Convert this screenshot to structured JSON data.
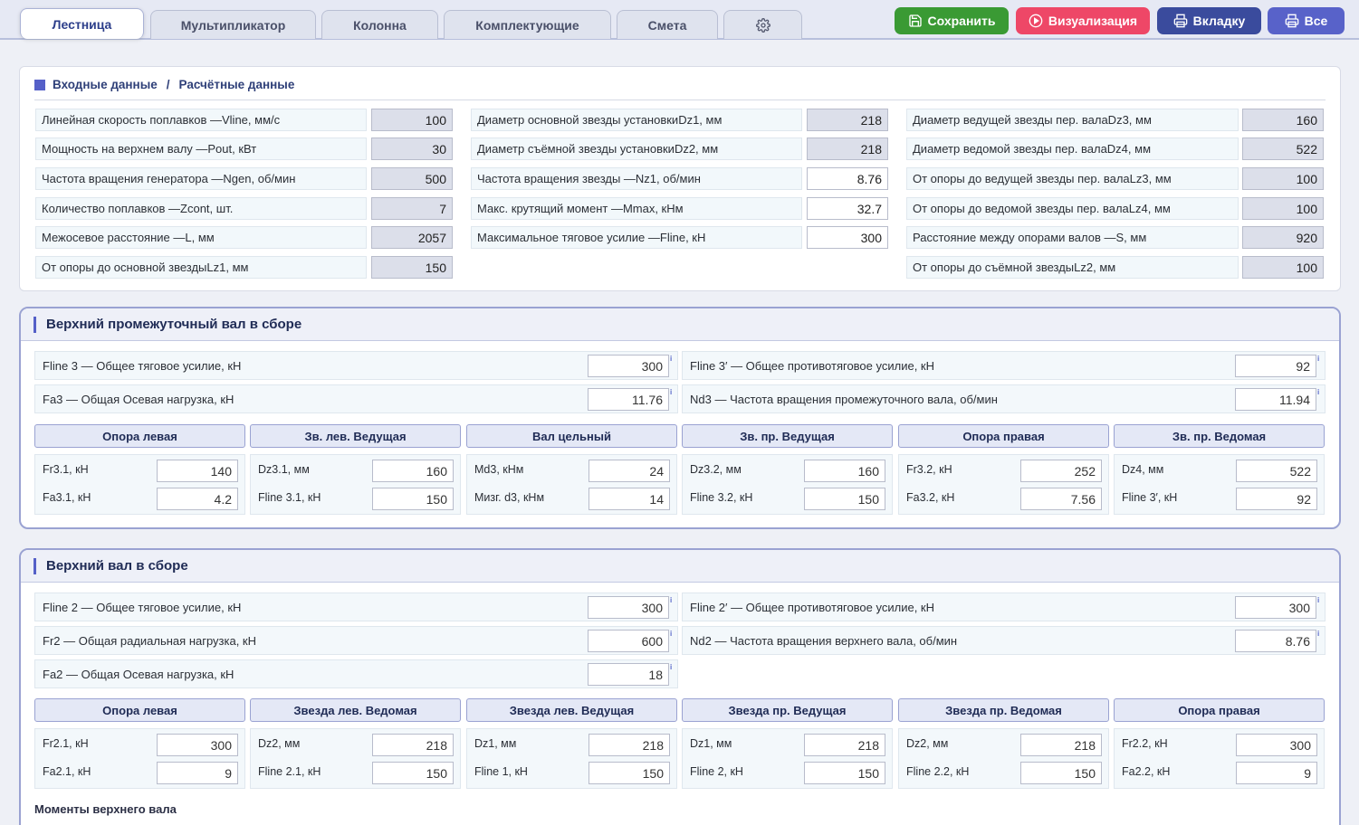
{
  "tabs": [
    "Лестница",
    "Мультипликатор",
    "Колонна",
    "Комплектующие",
    "Смета"
  ],
  "toolbar": {
    "save": "Сохранить",
    "visual": "Визуализация",
    "tab_print": "Вкладку",
    "all_print": "Все",
    "colors": {
      "save": "#3a9a34",
      "visual": "#ee4767",
      "tab_print": "#3a4b9d",
      "all_print": "#5862c9"
    }
  },
  "input_card": {
    "title_in": "Входные данные",
    "sep": "/",
    "title_out": "Расчётные данные",
    "col1": [
      {
        "label": "Линейная скорость поплавков —Vline, мм/с",
        "value": "100"
      },
      {
        "label": "Мощность на верхнем валу —Pout, кВт",
        "value": "30"
      },
      {
        "label": "Частота вращения генератора —Ngen, об/мин",
        "value": "500"
      },
      {
        "label": "Количество поплавков —Zcont, шт.",
        "value": "7"
      },
      {
        "label": "Межосевое расстояние —L, мм",
        "value": "2057"
      },
      {
        "label": "От опоры до основной звездыLz1, мм",
        "value": "150"
      }
    ],
    "col2": [
      {
        "label": "Диаметр основной звезды установкиDz1, мм",
        "value": "218"
      },
      {
        "label": "Диаметр съёмной звезды установкиDz2, мм",
        "value": "218"
      },
      {
        "label": "Частота вращения звезды —Nz1, об/мин",
        "value": "8.76"
      },
      {
        "label": "Макс. крутящий момент —Mmax, кНм",
        "value": "32.7"
      },
      {
        "label": "Максимальное тяговое усилие —Fline, кН",
        "value": "300"
      }
    ],
    "col3": [
      {
        "label": "Диаметр ведущей звезды пер. валаDz3, мм",
        "value": "160"
      },
      {
        "label": "Диаметр ведомой звезды пер. валаDz4, мм",
        "value": "522"
      },
      {
        "label": "От опоры до ведущей звезды пер. валаLz3, мм",
        "value": "100"
      },
      {
        "label": "От опоры до ведомой звезды пер. валаLz4, мм",
        "value": "100"
      },
      {
        "label": "Расстояние между опорами валов —S, мм",
        "value": "920"
      },
      {
        "label": "От опоры до съёмной звездыLz2, мм",
        "value": "100"
      }
    ]
  },
  "sec1": {
    "title": "Верхний промежуточный вал в сборе",
    "rows": [
      {
        "label": "Fline 3 — Общее тяговое усилие, кН",
        "value": "300"
      },
      {
        "label": "Fline 3′ — Общее противотяговое усилие, кН",
        "value": "92"
      },
      {
        "label": "Fa3 — Общая Осевая нагрузка, кН",
        "value": "11.76"
      },
      {
        "label": "Nd3 — Частота вращения промежуточного вала, об/мин",
        "value": "11.94"
      }
    ],
    "cols": [
      {
        "head": "Опора левая",
        "l1": "Fr3.1, кН",
        "v1": "140",
        "l2": "Fa3.1, кН",
        "v2": "4.2"
      },
      {
        "head": "Зв. лев. Ведущая",
        "l1": "Dz3.1, мм",
        "v1": "160",
        "l2": "Fline 3.1, кН",
        "v2": "150"
      },
      {
        "head": "Вал цельный",
        "l1": "Md3, кНм",
        "v1": "24",
        "l2": "Mизг. d3, кНм",
        "v2": "14"
      },
      {
        "head": "Зв. пр. Ведущая",
        "l1": "Dz3.2, мм",
        "v1": "160",
        "l2": "Fline 3.2, кН",
        "v2": "150"
      },
      {
        "head": "Опора правая",
        "l1": "Fr3.2, кН",
        "v1": "252",
        "l2": "Fa3.2, кН",
        "v2": "7.56"
      },
      {
        "head": "Зв. пр. Ведомая",
        "l1": "Dz4, мм",
        "v1": "522",
        "l2": "Fline 3′, кН",
        "v2": "92"
      }
    ]
  },
  "sec2": {
    "title": "Верхний вал в сборе",
    "rows": [
      {
        "label": "Fline 2 — Общее тяговое усилие, кН",
        "value": "300"
      },
      {
        "label": "Fline 2′ — Общее противотяговое усилие, кН",
        "value": "300"
      },
      {
        "label": "Fr2 — Общая радиальная нагрузка, кН",
        "value": "600"
      },
      {
        "label": "Nd2 — Частота вращения верхнего вала, об/мин",
        "value": "8.76"
      },
      {
        "label": "Fa2 — Общая Осевая нагрузка, кН",
        "value": "18"
      }
    ],
    "cols": [
      {
        "head": "Опора левая",
        "l1": "Fr2.1, кН",
        "v1": "300",
        "l2": "Fa2.1, кН",
        "v2": "9"
      },
      {
        "head": "Звезда лев. Ведомая",
        "l1": "Dz2, мм",
        "v1": "218",
        "l2": "Fline 2.1, кН",
        "v2": "150"
      },
      {
        "head": "Звезда лев. Ведущая",
        "l1": "Dz1, мм",
        "v1": "218",
        "l2": "Fline 1, кН",
        "v2": "150"
      },
      {
        "head": "Звезда пр. Ведущая",
        "l1": "Dz1, мм",
        "v1": "218",
        "l2": "Fline 2, кН",
        "v2": "150"
      },
      {
        "head": "Звезда пр. Ведомая",
        "l1": "Dz2, мм",
        "v1": "218",
        "l2": "Fline 2.2, кН",
        "v2": "150"
      },
      {
        "head": "Опора правая",
        "l1": "Fr2.2, кН",
        "v1": "300",
        "l2": "Fa2.2, кН",
        "v2": "9"
      }
    ]
  },
  "moments_title": "Моменты верхнего вала"
}
